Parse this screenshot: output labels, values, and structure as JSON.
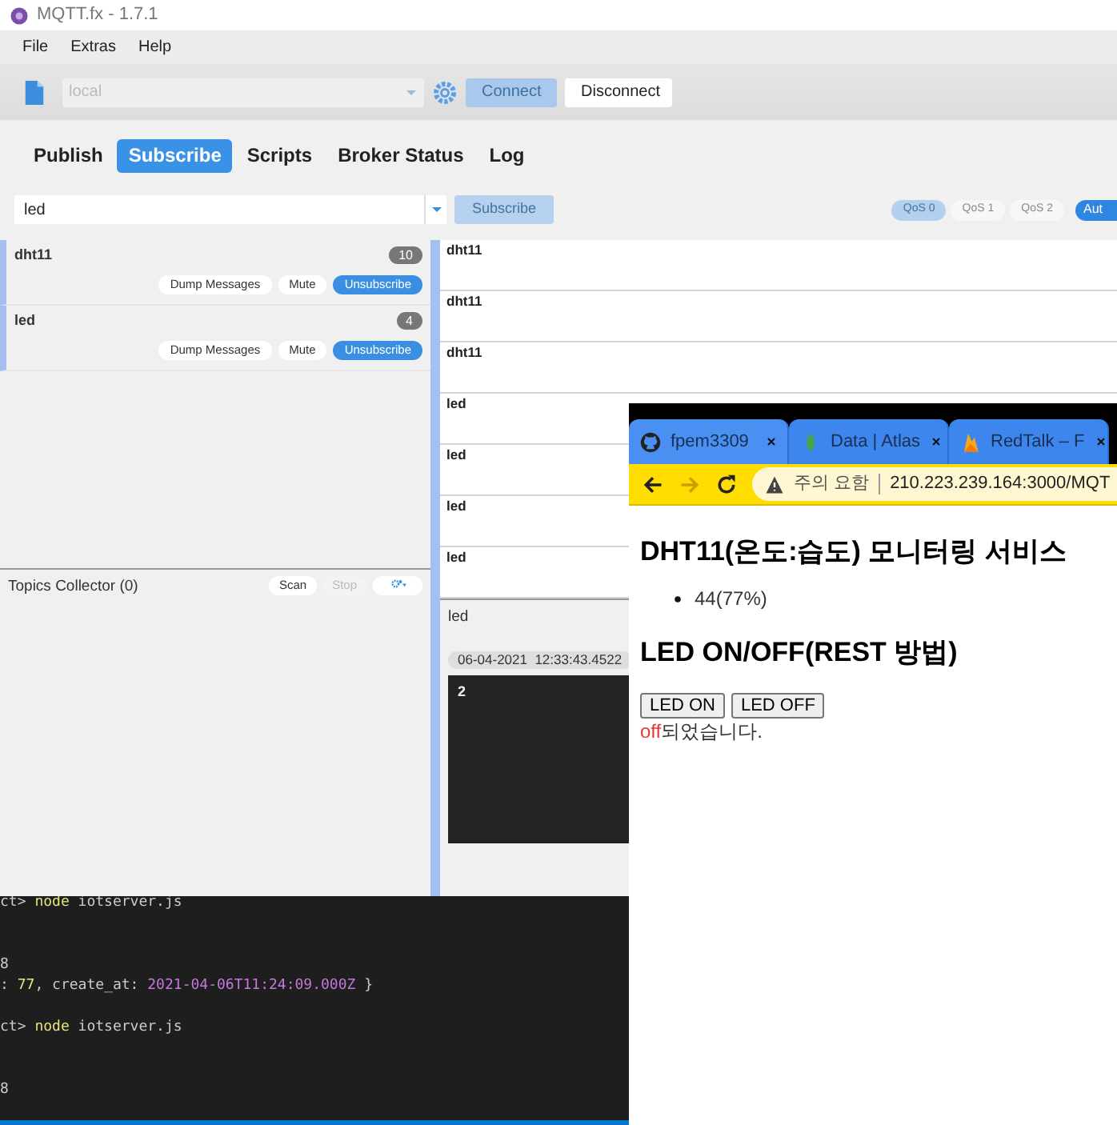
{
  "terminal": {
    "lines": [
      {
        "kind": "text",
        "segments": [
          {
            "text": "ct> ",
            "kind": "plain"
          },
          {
            "text": "node",
            "kind": "command"
          },
          {
            "text": " iotserver.js",
            "kind": "plain"
          }
        ]
      },
      {
        "kind": "blank"
      },
      {
        "kind": "blank"
      },
      {
        "kind": "text",
        "segments": [
          {
            "text": "8",
            "kind": "plain"
          }
        ]
      },
      {
        "kind": "text",
        "segments": [
          {
            "text": ": ",
            "kind": "plain"
          },
          {
            "text": "77",
            "kind": "number"
          },
          {
            "text": ", create_at: ",
            "kind": "plain"
          },
          {
            "text": "2021-04-06T11:24:09.000Z",
            "kind": "date"
          },
          {
            "text": " }",
            "kind": "plain"
          }
        ]
      },
      {
        "kind": "blank"
      },
      {
        "kind": "text",
        "segments": [
          {
            "text": "ct> ",
            "kind": "plain"
          },
          {
            "text": "node",
            "kind": "command"
          },
          {
            "text": " iotserver.js",
            "kind": "plain"
          }
        ]
      },
      {
        "kind": "blank"
      },
      {
        "kind": "blank"
      },
      {
        "kind": "text",
        "segments": [
          {
            "text": "8",
            "kind": "plain"
          }
        ]
      }
    ]
  },
  "mqtt": {
    "window": {
      "title": "MQTT.fx - 1.7.1"
    },
    "menu": [
      "File",
      "Extras",
      "Help"
    ],
    "toolbar": {
      "profile": {
        "value": "local",
        "disabled": true
      },
      "buttons": [
        {
          "label": "Connect",
          "disabled": true
        },
        {
          "label": "Disconnect",
          "disabled": false
        }
      ]
    },
    "tabs": [
      {
        "label": "Publish",
        "selected": false
      },
      {
        "label": "Subscribe",
        "selected": true
      },
      {
        "label": "Scripts",
        "selected": false
      },
      {
        "label": "Broker Status",
        "selected": false
      },
      {
        "label": "Log",
        "selected": false
      }
    ],
    "subscribe_bar": {
      "topic": "led",
      "button": {
        "label": "Subscribe",
        "disabled": true
      },
      "qos": [
        {
          "label": "QoS 0",
          "selected": true
        },
        {
          "label": "QoS 1",
          "selected": false
        },
        {
          "label": "QoS 2",
          "selected": false
        }
      ],
      "auto_button": "Aut"
    },
    "subscriptions": [
      {
        "topic": "dht11",
        "count": "10",
        "buttons": [
          "Dump Messages",
          "Mute",
          "Unsubscribe"
        ]
      },
      {
        "topic": "led",
        "count": "4",
        "buttons": [
          "Dump Messages",
          "Mute",
          "Unsubscribe"
        ]
      }
    ],
    "topics_collector": {
      "title": "Topics Collector (0)",
      "buttons": [
        {
          "label": "Scan",
          "disabled": false
        },
        {
          "label": "Stop",
          "disabled": true
        }
      ]
    },
    "messages": [
      "dht11",
      "dht11",
      "dht11",
      "led",
      "led",
      "led",
      "led"
    ],
    "detail": {
      "topic": "led",
      "timestamp": "06-04-2021  12:33:43.4522",
      "payload": "2"
    }
  },
  "browser": {
    "tabs": [
      {
        "title": "fpem3309",
        "selected": true
      },
      {
        "title": "Data | Atlas",
        "selected": false
      },
      {
        "title": "RedTalk – F",
        "selected": false
      }
    ],
    "nav": {
      "back_disabled": false,
      "forward_disabled": true
    },
    "address": {
      "warning": "주의 요함",
      "url": "210.223.239.164:3000/MQT"
    },
    "page": {
      "heading1": "DHT11(온도:습도) 모니터링 서비스",
      "readings": [
        "44(77%)"
      ],
      "heading2": "LED ON/OFF(REST 방법)",
      "buttons": [
        "LED ON",
        "LED OFF"
      ],
      "status": {
        "value": "off",
        "message": "되었습니다."
      }
    }
  }
}
